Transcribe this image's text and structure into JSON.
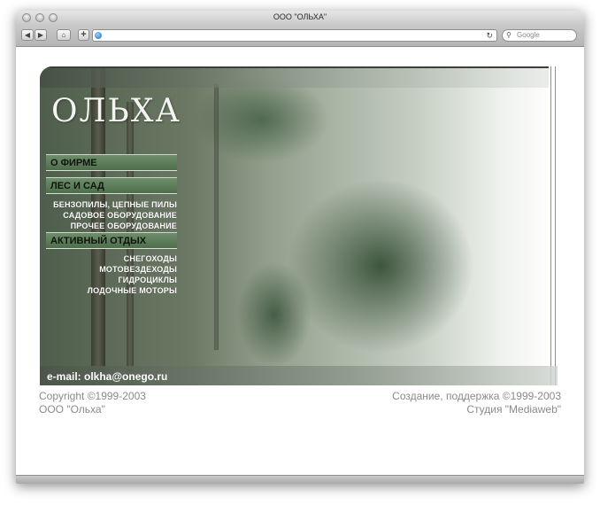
{
  "window": {
    "title": "ООО \"ОЛЬХА\""
  },
  "toolbar": {
    "back_icon": "back-arrow-icon",
    "forward_icon": "forward-arrow-icon",
    "home_icon": "home-icon",
    "add_icon": "plus-icon",
    "reload_icon": "reload-icon",
    "search_placeholder": "Google"
  },
  "page": {
    "logo": "ОЛЬХА",
    "nav": {
      "about": "О ФИРМЕ",
      "forest": "ЛЕС И САД",
      "forest_items": [
        "БЕНЗОПИЛЫ, ЦЕПНЫЕ ПИЛЫ",
        "САДОВОЕ ОБОРУДОВАНИЕ",
        "ПРОЧЕЕ ОБОРУДОВАНИЕ"
      ],
      "active": "АКТИВНЫЙ ОТДЫХ",
      "active_items": [
        "СНЕГОХОДЫ",
        "МОТОВЕЗДЕХОДЫ",
        "ГИДРОЦИКЛЫ",
        "ЛОДОЧНЫЕ МОТОРЫ"
      ]
    },
    "email": "e-mail: olkha@onego.ru",
    "footer": {
      "copyright": "Copyright ©1999-2003",
      "company": "ООО \"Ольха\"",
      "creation": "Создание, поддержка ©1999-2003",
      "studio": "Студия \"Mediaweb\""
    }
  }
}
